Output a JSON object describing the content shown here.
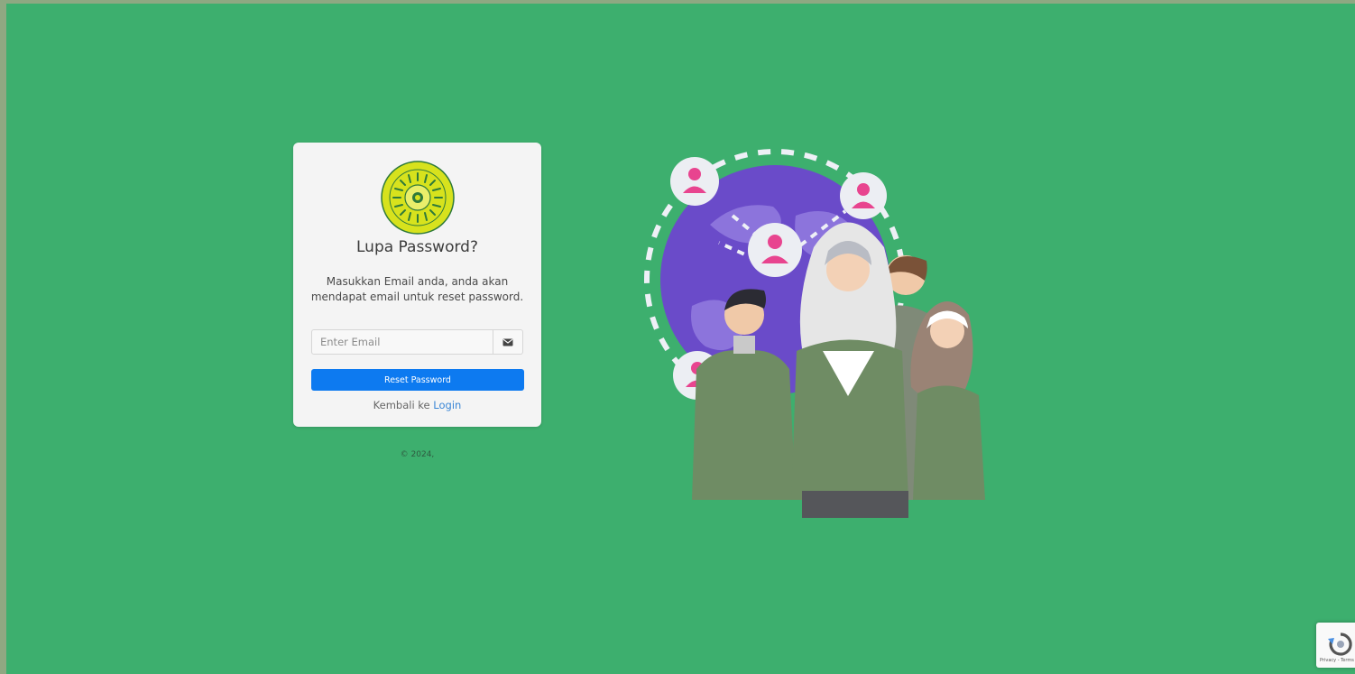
{
  "form": {
    "title": "Lupa Password?",
    "description": "Masukkan Email anda, anda akan mendapat email untuk reset password.",
    "email_placeholder": "Enter Email",
    "email_value": "",
    "submit_label": "Reset Password",
    "back_text": "Kembali ke",
    "login_link": "Login"
  },
  "footer": {
    "copyright": "© 2024,"
  },
  "recaptcha": {
    "text": "Privacy - Terms"
  },
  "icons": {
    "logo": "university-seal-logo",
    "email": "envelope-icon",
    "recaptcha": "recaptcha-icon"
  },
  "colors": {
    "background": "#3daf6e",
    "primary_button": "#0d7af0",
    "link": "#3a86d6",
    "card": "#f4f4f4"
  }
}
